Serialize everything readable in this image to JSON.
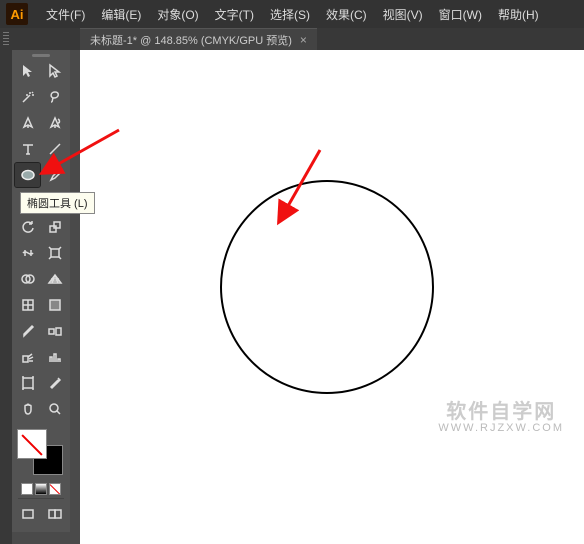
{
  "app": {
    "logo": "Ai"
  },
  "menu": {
    "file": "文件(F)",
    "edit": "编辑(E)",
    "object": "对象(O)",
    "text": "文字(T)",
    "select": "选择(S)",
    "effect": "效果(C)",
    "view": "视图(V)",
    "window": "窗口(W)",
    "help": "帮助(H)"
  },
  "tab": {
    "title": "未标题-1* @ 148.85% (CMYK/GPU 预览)",
    "close": "×"
  },
  "tooltip": {
    "ellipse": "椭圆工具 (L)"
  },
  "watermark": {
    "cn": "软件自学网",
    "url": "WWW.RJZXW.COM"
  },
  "colors": {
    "accent": "#ff9a00",
    "arrow": "#f01010"
  }
}
